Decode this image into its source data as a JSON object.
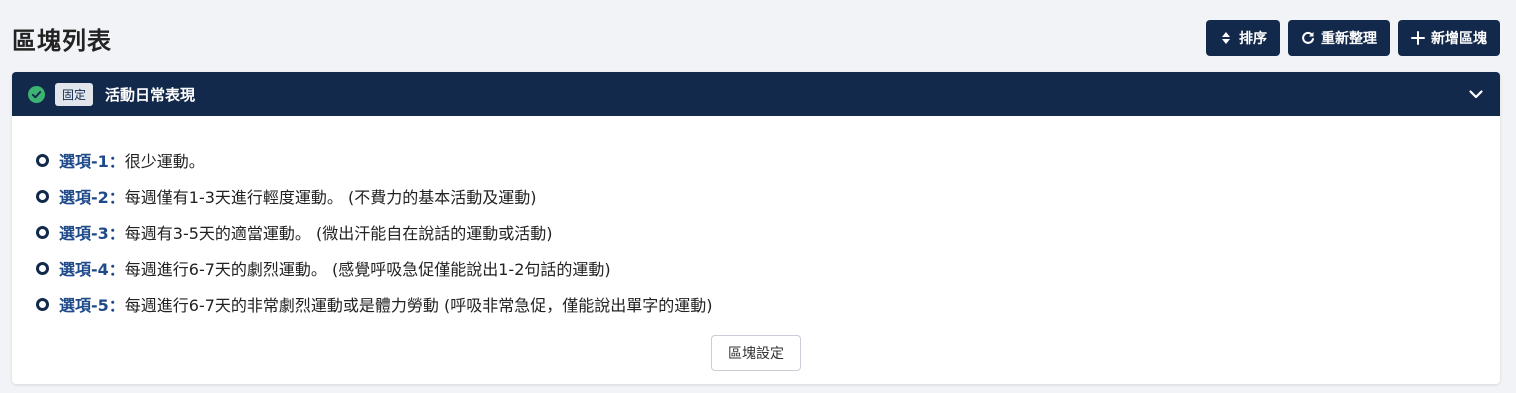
{
  "page": {
    "title": "區塊列表"
  },
  "toolbar": {
    "sort_label": "排序",
    "refresh_label": "重新整理",
    "add_label": "新增區塊"
  },
  "block": {
    "badge": "固定",
    "title": "活動日常表現",
    "options": [
      {
        "label": "選項-1：",
        "text": "很少運動。"
      },
      {
        "label": "選項-2：",
        "text": "每週僅有1-3天進行輕度運動。 (不費力的基本活動及運動)"
      },
      {
        "label": "選項-3：",
        "text": "每週有3-5天的適當運動。 (微出汗能自在說話的運動或活動)"
      },
      {
        "label": "選項-4：",
        "text": "每週進行6-7天的劇烈運動。 (感覺呼吸急促僅能說出1-2句話的運動)"
      },
      {
        "label": "選項-5：",
        "text": "每週進行6-7天的非常劇烈運動或是體力勞動 (呼吸非常急促，僅能說出單字的運動)"
      }
    ],
    "settings_label": "區塊設定"
  },
  "colors": {
    "primary": "#13294b",
    "success": "#3cb371",
    "option_label": "#1f4a8a"
  }
}
